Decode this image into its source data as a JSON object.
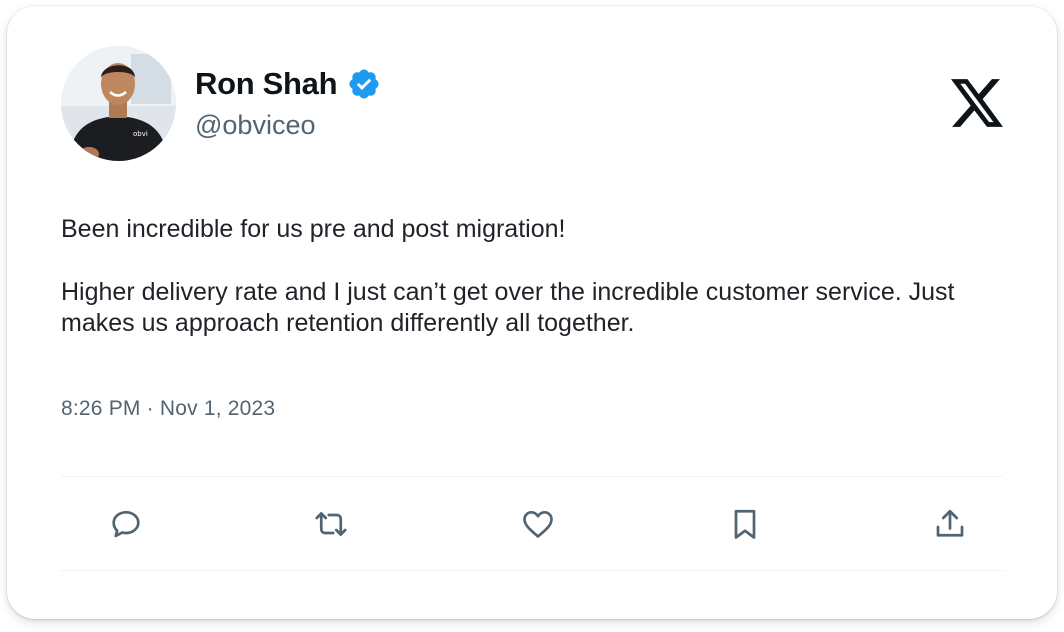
{
  "tweet": {
    "author": {
      "name": "Ron Shah",
      "handle": "@obviceo",
      "avatar_icon": "profile-photo",
      "verified_icon": "verified-badge-icon",
      "verified_color": "#1d9bf0",
      "shirt_logo": "obvi"
    },
    "platform_icon": "x-logo-icon",
    "body": [
      "Been incredible for us pre and post migration!",
      "Higher delivery rate and I just can’t get over the incredible customer service. Just makes us approach retention differently all together."
    ],
    "timestamp": "8:26 PM · Nov 1, 2023",
    "actions": [
      {
        "name": "reply",
        "icon": "speech-bubble-icon"
      },
      {
        "name": "retweet",
        "icon": "retweet-arrows-icon"
      },
      {
        "name": "like",
        "icon": "heart-icon"
      },
      {
        "name": "bookmark",
        "icon": "bookmark-icon"
      },
      {
        "name": "share",
        "icon": "share-upload-icon"
      }
    ]
  },
  "colors": {
    "text_primary": "#0f1419",
    "text_secondary": "#536471",
    "icon_color": "#536471",
    "divider": "#eff3f4"
  }
}
